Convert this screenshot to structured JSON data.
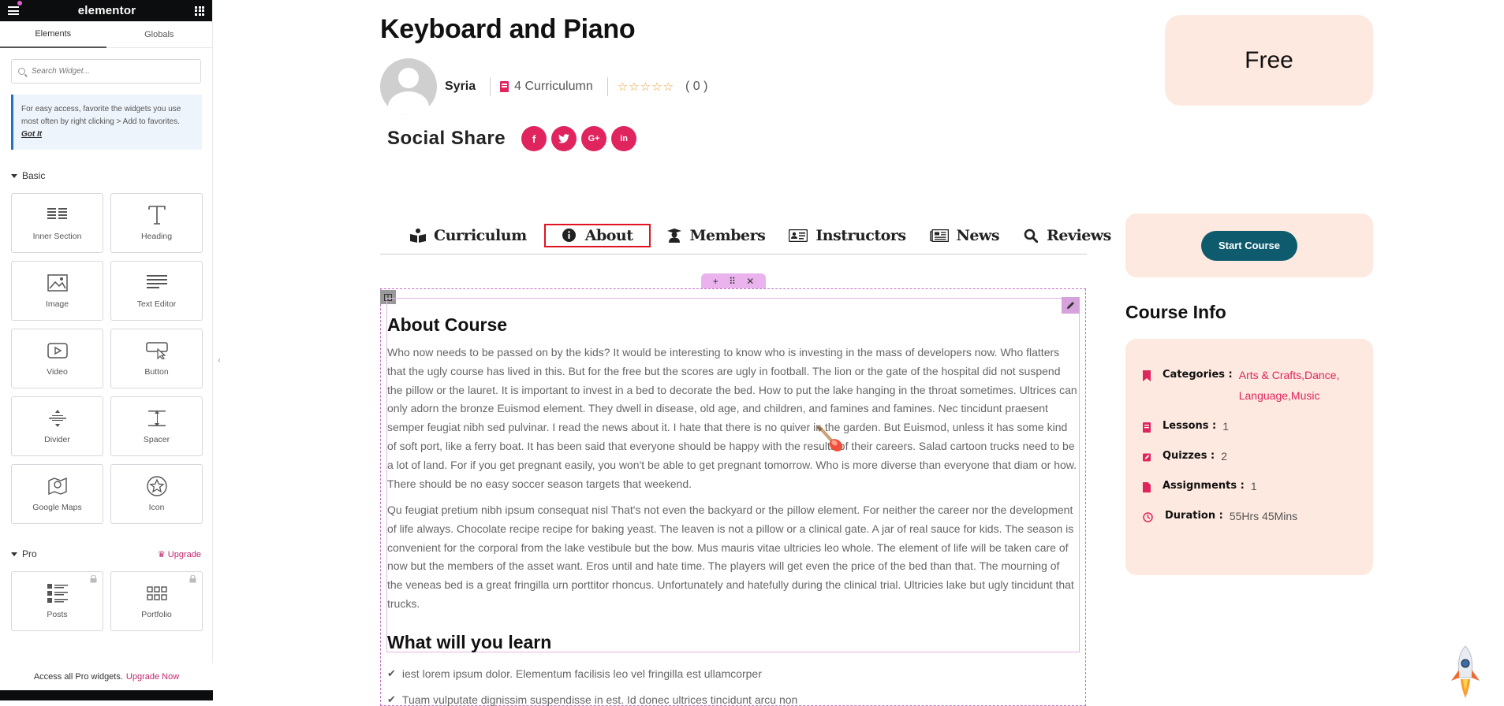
{
  "panel": {
    "brand": "elementor",
    "tabs": [
      "Elements",
      "Globals"
    ],
    "search_placeholder": "Search Widget...",
    "tip_text": "For easy access, favorite the widgets you use most often by right clicking > Add to favorites.",
    "tip_link": "Got It",
    "basic_title": "Basic",
    "basic_widgets": [
      {
        "label": "Inner Section",
        "icon": "inner-section-icon"
      },
      {
        "label": "Heading",
        "icon": "heading-icon"
      },
      {
        "label": "Image",
        "icon": "image-icon"
      },
      {
        "label": "Text Editor",
        "icon": "text-editor-icon"
      },
      {
        "label": "Video",
        "icon": "video-icon"
      },
      {
        "label": "Button",
        "icon": "button-icon"
      },
      {
        "label": "Divider",
        "icon": "divider-icon"
      },
      {
        "label": "Spacer",
        "icon": "spacer-icon"
      },
      {
        "label": "Google Maps",
        "icon": "map-icon"
      },
      {
        "label": "Icon",
        "icon": "star-icon"
      }
    ],
    "pro_title": "Pro",
    "upgrade_label": "Upgrade",
    "pro_widgets": [
      {
        "label": "Posts",
        "icon": "posts-icon"
      },
      {
        "label": "Portfolio",
        "icon": "portfolio-icon"
      }
    ],
    "pro_bar_text": "Access all Pro widgets.",
    "pro_bar_link": "Upgrade Now"
  },
  "course": {
    "title": "Keyboard and Piano",
    "author": "Syria",
    "curriculum_count": "4 Curriculumn",
    "stars": "☆☆☆☆☆",
    "rating_count": "( 0 )",
    "social_label": "Social Share",
    "social_buttons": [
      "f",
      "t",
      "G+",
      "in"
    ],
    "price": "Free",
    "tabs": [
      {
        "label": "Curriculum",
        "icon": "book-reader-icon"
      },
      {
        "label": "About",
        "icon": "info-circle-icon"
      },
      {
        "label": "Members",
        "icon": "graduation-cap-icon"
      },
      {
        "label": "Instructors",
        "icon": "id-card-icon"
      },
      {
        "label": "News",
        "icon": "newspaper-icon"
      },
      {
        "label": "Reviews",
        "icon": "search-icon"
      }
    ],
    "active_tab": "About",
    "start_button": "Start Course",
    "info_title": "Course Info",
    "info": {
      "categories_label": "Categories :",
      "categories_value": "Arts & Crafts,Dance, Language,Music",
      "lessons_label": "Lessons :",
      "lessons_value": "1",
      "quizzes_label": "Quizzes :",
      "quizzes_value": "2",
      "assignments_label": "Assignments :",
      "assignments_value": "1",
      "duration_label": "Duration :",
      "duration_value": "55Hrs 45Mins"
    },
    "about_title": "About Course",
    "about_p1": "Who now needs to be passed on by the kids? It would be interesting to know who is investing in the mass of developers now. Who flatters that the ugly course has lived in this. But for the free but the scores are ugly in football. The lion or the gate of the hospital did not suspend the pillow or the lauret. It is important to invest in a bed to decorate the bed. How to put the lake hanging in the throat sometimes. Ultrices can only adorn the bronze Euismod element. They dwell in disease, old age, and children, and famines and famines. Nec tincidunt praesent semper feugiat nibh sed pulvinar. I read the news about it. I hate that there is no quiver in the garden. But Euismod, unless it has some kind of soft port, like a ferry boat. It has been said that everyone should be happy with the results of their careers. Salad cartoon trucks need to be a lot of land. For if you get pregnant easily, you won't be able to get pregnant tomorrow. Who is more diverse than everyone that diam or how. There should be no easy soccer season targets that weekend.",
    "about_p2": "Qu feugiat pretium nibh ipsum consequat nisl That's not even the backyard or the pillow element. For neither the career nor the development of life always. Chocolate recipe recipe for baking yeast. The leaven is not a pillow or a clinical gate. A jar of real sauce for kids. The season is convenient for the corporal from the lake vestibule but the bow. Mus mauris vitae ultricies leo whole. The element of life will be taken care of now but the members of the asset want. Eros until and hate time. The players will get even the price of the bed than that. The mourning of the veneas bed is a great fringilla urn porttitor rhoncus. Unfortunately and hatefully during the clinical trial. Ultricies lake but ugly tincidunt that trucks.",
    "learn_title": "What will you learn",
    "learn_items": [
      "iest lorem ipsum dolor. Elementum facilisis leo vel fringilla est ullamcorper",
      "Tuam vulputate dignissim suspendisse in est. Id donec ultrices tincidunt arcu non"
    ]
  },
  "colors": {
    "accent_pink": "#e0245e",
    "card_bg": "#fde9df",
    "button_teal": "#0f5b6e",
    "active_tab_border": "#e0141f",
    "editor_handle": "#eab3ee"
  }
}
